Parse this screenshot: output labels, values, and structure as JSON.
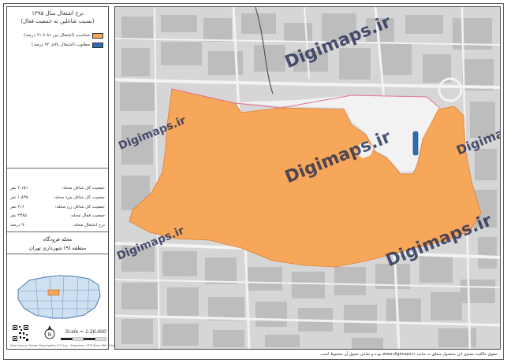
{
  "legend": {
    "title_line1": "نرخ اشتغال سال ۱۳۹۵",
    "title_line2": "(نسبت شاغلین به جمعیت فعال)",
    "items": [
      {
        "label": "متناسب (اشتغال بین ۸۱ تا ۹۱ درصد)",
        "color": "#f7a75a"
      },
      {
        "label": "مطلوب (اشتغال بالای ۹۲ درصد)",
        "color": "#2d6db5"
      }
    ],
    "stats": [
      {
        "label": "جمعیت کل شاغل محله:",
        "value": "۲,۱۵۱ نفر"
      },
      {
        "label": "جمعیت کل شاغل مرد محله:",
        "value": "۱,۸۳۵ نفر"
      },
      {
        "label": "جمعیت کل شاغل زن محله:",
        "value": "۲۱۶ نفر"
      },
      {
        "label": "جمعیت فعال محله:",
        "value": "۲۳۸۵ نفر"
      },
      {
        "label": "نرخ اشتغال محله:",
        "value": "۹۰ درصد"
      }
    ],
    "region_name": "محله فرودگاه",
    "district": "منطقه (۹) شهرداری تهران",
    "scale": "Scale = 1:26,000",
    "credit": "Data Source: Tehran Municipality ICT Org. - Projection: UTM Zone 39N - Ellipsoid: WGS84"
  },
  "map": {
    "land_color": "#d6d6d6",
    "block_color": "#b9b9b9",
    "road_color": "#f4f4f4",
    "highlight_color": "#f7a75a",
    "white_area_color": "#f2f2f2",
    "blue_marker_color": "#2d6db5",
    "watermark": "Digimaps.ir"
  },
  "footer": "حقوق مالکیت معنوی این محصول متعلق به سایت www.digimaps.ir بوده و تمامی حقوق آن محفوظ است."
}
